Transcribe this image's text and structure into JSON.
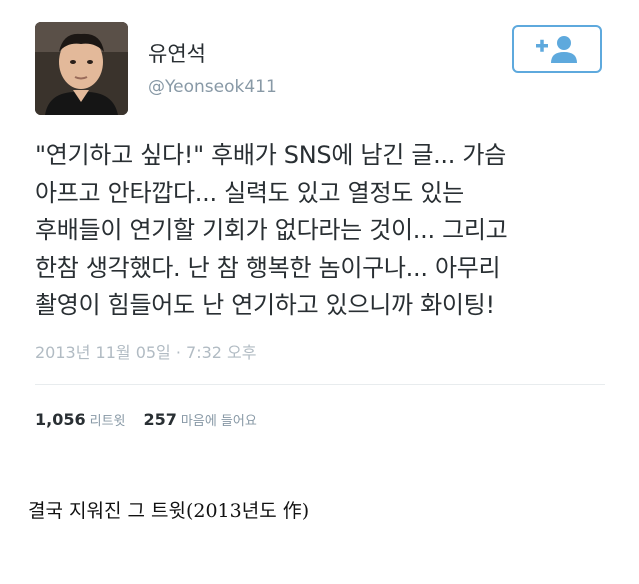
{
  "profile": {
    "display_name": "유연석",
    "username": "@Yeonseok411",
    "avatar_icon": "profile-photo",
    "follow_icon": "add-user-icon"
  },
  "tweet": {
    "lines": [
      "\"연기하고 싶다!\" 후배가 SNS에 남긴 글... 가슴",
      "아프고 안타깝다... 실력도 있고 열정도 있는",
      "후배들이 연기할 기회가 없다라는 것이... 그리고",
      "한참 생각했다. 난 참 행복한 놈이구나... 아무리",
      "촬영이 힘들어도 난 연기하고 있으니까 화이팅!"
    ],
    "timestamp": "2013년 11월 05일 · 7:32 오후"
  },
  "stats": {
    "retweets_count": "1,056",
    "retweets_label": "리트윗",
    "likes_count": "257",
    "likes_label": "마음에 들어요"
  },
  "caption": "결국 지워진 그 트윗(2013년도 作)",
  "colors": {
    "accent": "#5ea9dd",
    "muted": "#8899a6",
    "text": "#292f33"
  }
}
